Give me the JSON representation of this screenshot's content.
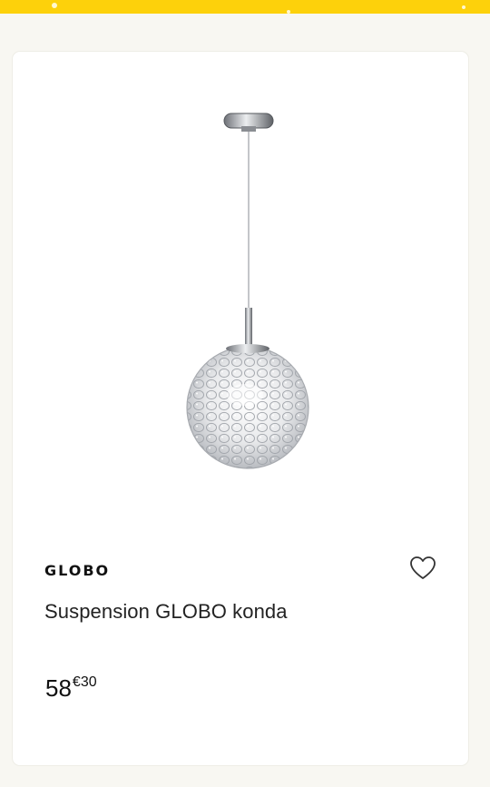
{
  "product": {
    "brand": "GLOBO",
    "title": "Suspension GLOBO konda",
    "price_integer": "58",
    "price_decimal": "€30"
  },
  "icons": {
    "favorite": "heart-outline-icon"
  },
  "colors": {
    "accent": "#fdd10b",
    "background": "#f8f7f2",
    "card": "#ffffff",
    "text": "#222222"
  }
}
